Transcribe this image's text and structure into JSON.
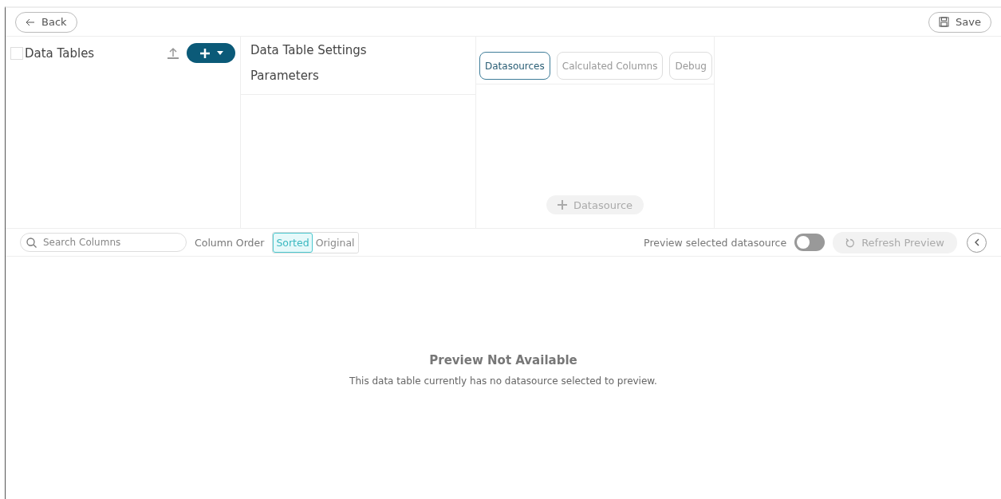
{
  "toolbar": {
    "back": "Back",
    "save": "Save"
  },
  "data_tables": {
    "title": "Data Tables",
    "checked": false
  },
  "settings_menu": [
    "Data Table Settings",
    "Parameters"
  ],
  "tabs": [
    {
      "label": "Datasources",
      "selected": true
    },
    {
      "label": "Calculated Columns",
      "selected": false
    },
    {
      "label": "Debug",
      "selected": false
    }
  ],
  "add_datasource": "Datasource",
  "column_bar": {
    "search_placeholder": "Search Columns",
    "order_label": "Column Order",
    "order_options": [
      {
        "label": "Sorted",
        "selected": true
      },
      {
        "label": "Original",
        "selected": false
      }
    ],
    "preview_label": "Preview selected datasource",
    "preview_on": false,
    "refresh": "Refresh Preview"
  },
  "preview": {
    "title": "Preview Not Available",
    "message": "This data table currently has no datasource selected to preview."
  }
}
